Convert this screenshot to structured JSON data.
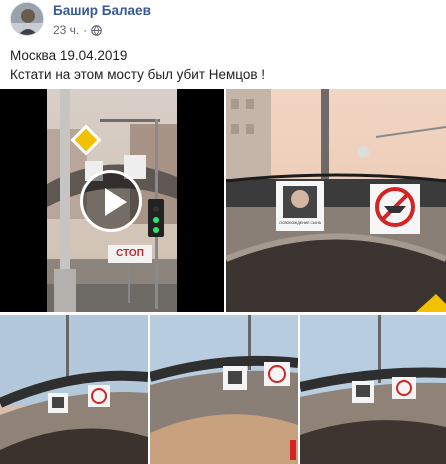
{
  "post": {
    "author": "Башир Балаев",
    "time": "23 ч.",
    "separator": "·",
    "privacy_icon": "globe-icon",
    "text_line_1": "Москва 19.04.2019",
    "text_line_2": "Кстати на этом мосту был убит Немцов !"
  },
  "media": {
    "video_sign_text": "СТОП",
    "play_icon": "play-icon",
    "banner_caption": "ОСВОБОЖДЕНИЕ СЫНА"
  },
  "colors": {
    "author_link": "#385898",
    "meta_text": "#606770",
    "sky_warm": "#e9cdb8",
    "sky_blue": "#b9cde0"
  }
}
